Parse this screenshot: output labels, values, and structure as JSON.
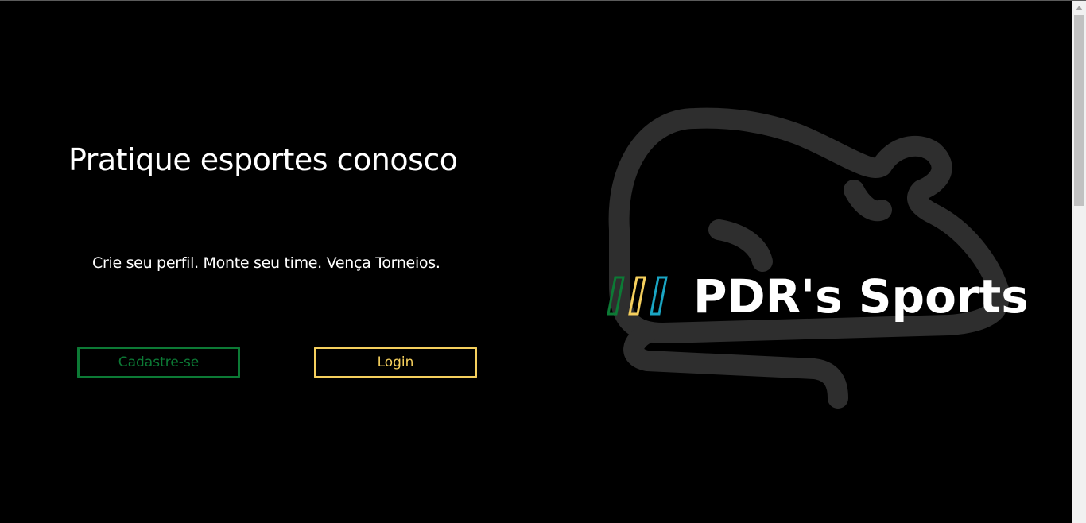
{
  "hero": {
    "headline": "Pratique esportes conosco",
    "tagline": "Crie seu perfil. Monte seu time. Vença Torneios."
  },
  "actions": {
    "signup_label": "Cadastre-se",
    "login_label": "Login"
  },
  "brand": {
    "name": "PDR's Sports",
    "stripe_colors": [
      "#0c7a35",
      "#f5cf5d",
      "#1aa6c4"
    ],
    "mascot_icon": "rat-mascot-icon"
  },
  "colors": {
    "background": "#000000",
    "signup_accent": "#0c7a35",
    "login_accent": "#f5cf5d",
    "mascot": "#2e2e2e"
  }
}
